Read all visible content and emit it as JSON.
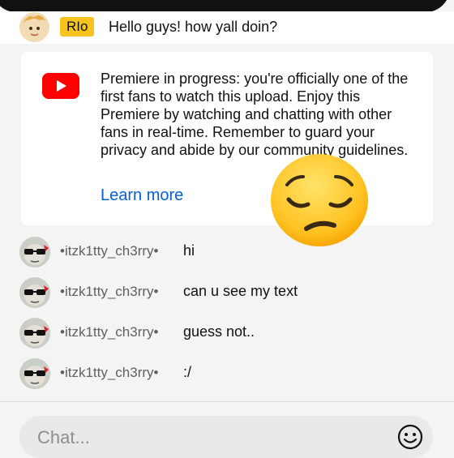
{
  "pinned": {
    "badge": "RIo",
    "message": "Hello guys! how yall doin?"
  },
  "premiere": {
    "text": "Premiere in progress: you're officially one of the first fans to watch this upload. Enjoy this Premiere by watching and chatting with other fans in real-time. Remember to guard your privacy and abide by our community guidelines.",
    "link": "Learn more"
  },
  "chat": {
    "messages": [
      {
        "author": "•itzk1tty_ch3rry•",
        "text": "hi"
      },
      {
        "author": "•itzk1tty_ch3rry•",
        "text": "can u see my text"
      },
      {
        "author": "•itzk1tty_ch3rry•",
        "text": "guess not.."
      },
      {
        "author": "•itzk1tty_ch3rry•",
        "text": ":/"
      }
    ]
  },
  "input": {
    "placeholder": "Chat..."
  },
  "icons": {
    "youtube": "youtube-icon",
    "emoji_picker": "smiley-icon",
    "sticker": "pensive-face-emoji"
  },
  "colors": {
    "youtube_red": "#ff0000",
    "link_blue": "#065fd4",
    "badge_yellow": "#f7c31e"
  }
}
